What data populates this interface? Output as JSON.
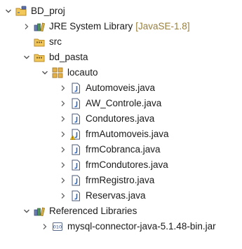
{
  "tree": {
    "project": {
      "label": "BD_proj"
    },
    "jre": {
      "label": "JRE System Library",
      "decoration": "[JavaSE-1.8]"
    },
    "src": {
      "label": "src"
    },
    "bd_pasta": {
      "label": "bd_pasta"
    },
    "package": {
      "label": "locauto"
    },
    "files": [
      {
        "label": "Automoveis.java",
        "icon": "java-file-icon"
      },
      {
        "label": "AW_Controle.java",
        "icon": "java-file-icon"
      },
      {
        "label": "Condutores.java",
        "icon": "java-file-icon"
      },
      {
        "label": "frmAutomoveis.java",
        "icon": "java-file-warning-icon"
      },
      {
        "label": "frmCobranca.java",
        "icon": "java-file-icon"
      },
      {
        "label": "frmCondutores.java",
        "icon": "java-file-icon"
      },
      {
        "label": "frmRegistro.java",
        "icon": "java-file-icon"
      },
      {
        "label": "Reservas.java",
        "icon": "java-file-icon"
      }
    ],
    "referenced": {
      "label": "Referenced Libraries"
    },
    "jar": {
      "label": "mysql-connector-java-5.1.48-bin.jar"
    }
  },
  "colors": {
    "text": "#1a1a1a",
    "decoration": "#9a7f3a",
    "twisty": "#555555",
    "folder": "#e8b53c",
    "package": "#b88a2a"
  }
}
